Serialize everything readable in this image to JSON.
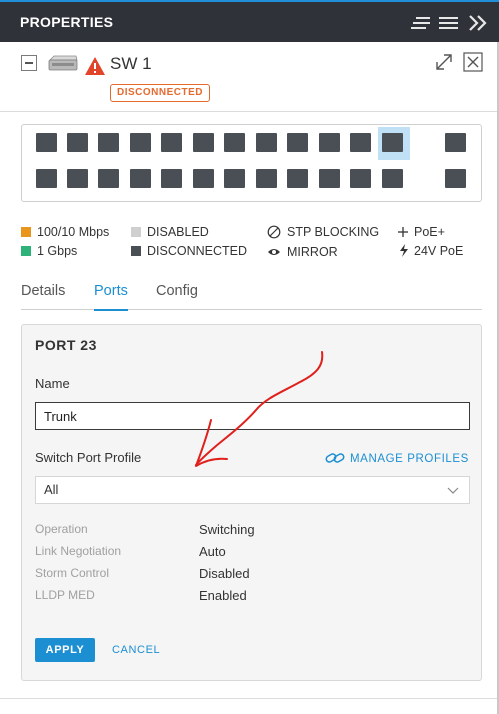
{
  "panel": {
    "title": "PROPERTIES",
    "icons": [
      "list-sort-icon",
      "menu-icon",
      "collapse-panel-icon"
    ]
  },
  "device": {
    "name": "SW 1",
    "status": "DISCONNECTED",
    "status_color": "#e56a2e",
    "icons": [
      "collapse-icon",
      "switch-device-icon",
      "warning-icon",
      "expand-icon",
      "close-icon"
    ]
  },
  "port_grid": {
    "selected_port": 23,
    "port_color": "#4a4e55",
    "selected_highlight": "#bfe0f5"
  },
  "legend": [
    {
      "label": "100/10 Mbps",
      "color": "#e8961e"
    },
    {
      "label": "1 Gbps",
      "color": "#2db37a"
    },
    {
      "label": "DISABLED",
      "color": "#cfcfcf"
    },
    {
      "label": "DISCONNECTED",
      "color": "#4a4e55"
    },
    {
      "label": "STP BLOCKING",
      "icon": "blocked-circle-icon"
    },
    {
      "label": "MIRROR",
      "icon": "eye-icon"
    },
    {
      "label": "PoE+",
      "icon": "plus-icon"
    },
    {
      "label": "24V PoE",
      "icon": "bolt-icon"
    }
  ],
  "tabs": [
    {
      "label": "Details",
      "active": false
    },
    {
      "label": "Ports",
      "active": true
    },
    {
      "label": "Config",
      "active": false
    }
  ],
  "port_form": {
    "title": "PORT 23",
    "name_label": "Name",
    "name_value": "Trunk",
    "profile_label": "Switch Port Profile",
    "manage_label": "MANAGE PROFILES",
    "profile_value": "All",
    "details": [
      {
        "key": "Operation",
        "value": "Switching"
      },
      {
        "key": "Link Negotiation",
        "value": "Auto"
      },
      {
        "key": "Storm Control",
        "value": "Disabled"
      },
      {
        "key": "LLDP MED",
        "value": "Enabled"
      }
    ],
    "apply_label": "APPLY",
    "cancel_label": "CANCEL"
  },
  "colors": {
    "accent": "#1c8fd2",
    "header_bg": "#2f3339",
    "annotation": "#e0201c"
  }
}
